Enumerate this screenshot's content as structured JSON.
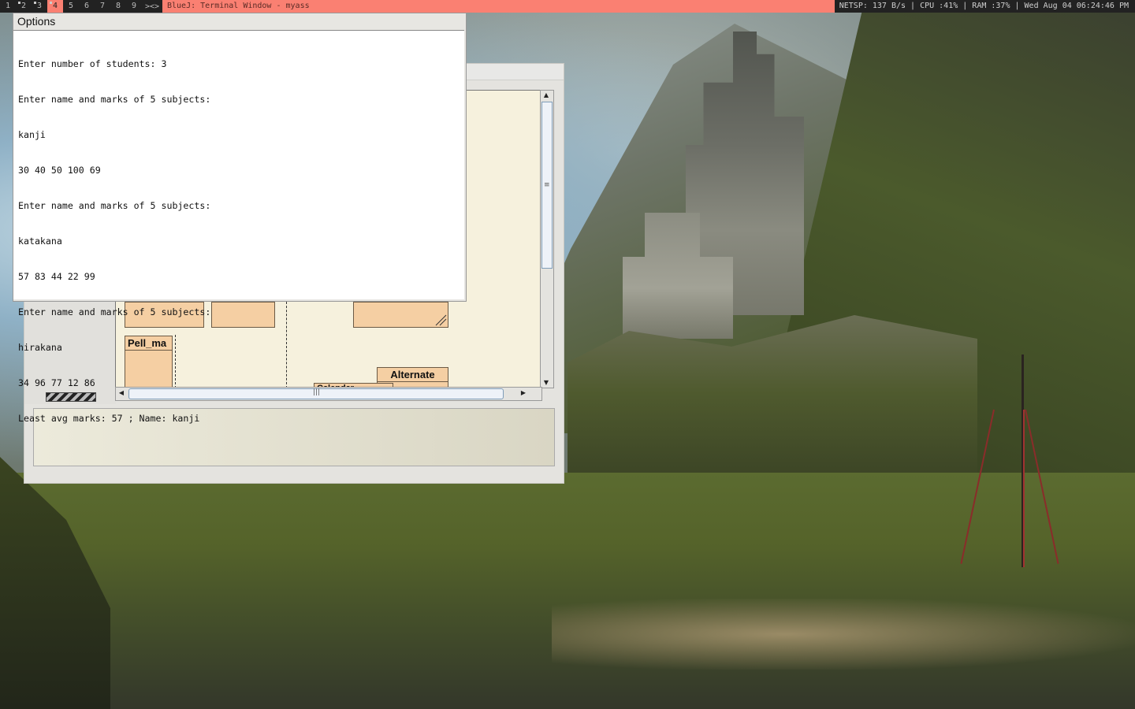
{
  "topbar": {
    "workspaces": [
      "1",
      "2",
      "3",
      "4",
      "5",
      "6",
      "7",
      "8",
      "9"
    ],
    "active_workspace": "4",
    "layout_indicator": "><>",
    "window_title": "BlueJ: Terminal Window - myass",
    "system_stats": "NETSP: 137 B/s | CPU :41% | RAM :37% | Wed Aug 04 06:24:46 PM",
    "accent_color": "#fa8072"
  },
  "options_window": {
    "title": "Options",
    "terminal_lines": [
      "Enter number of students: 3",
      "Enter name and marks of 5 subjects:",
      "kanji",
      "30 40 50 100 69",
      "Enter name and marks of 5 subjects:",
      "katakana",
      "57 83 44 22 99",
      "Enter name and marks of 5 subjects:",
      "hirakana",
      "34 96 77 12 86",
      "Least avg marks: 57 ; Name: kanji"
    ]
  },
  "bluej_window": {
    "classes": [
      {
        "label": ""
      },
      {
        "label": ""
      },
      {
        "label": ""
      },
      {
        "label": "Pell_ma"
      },
      {
        "label": "Alternate"
      },
      {
        "label": "Calendar"
      }
    ],
    "class_color": "#f5cfa3",
    "canvas_color": "#f6f1dd"
  }
}
